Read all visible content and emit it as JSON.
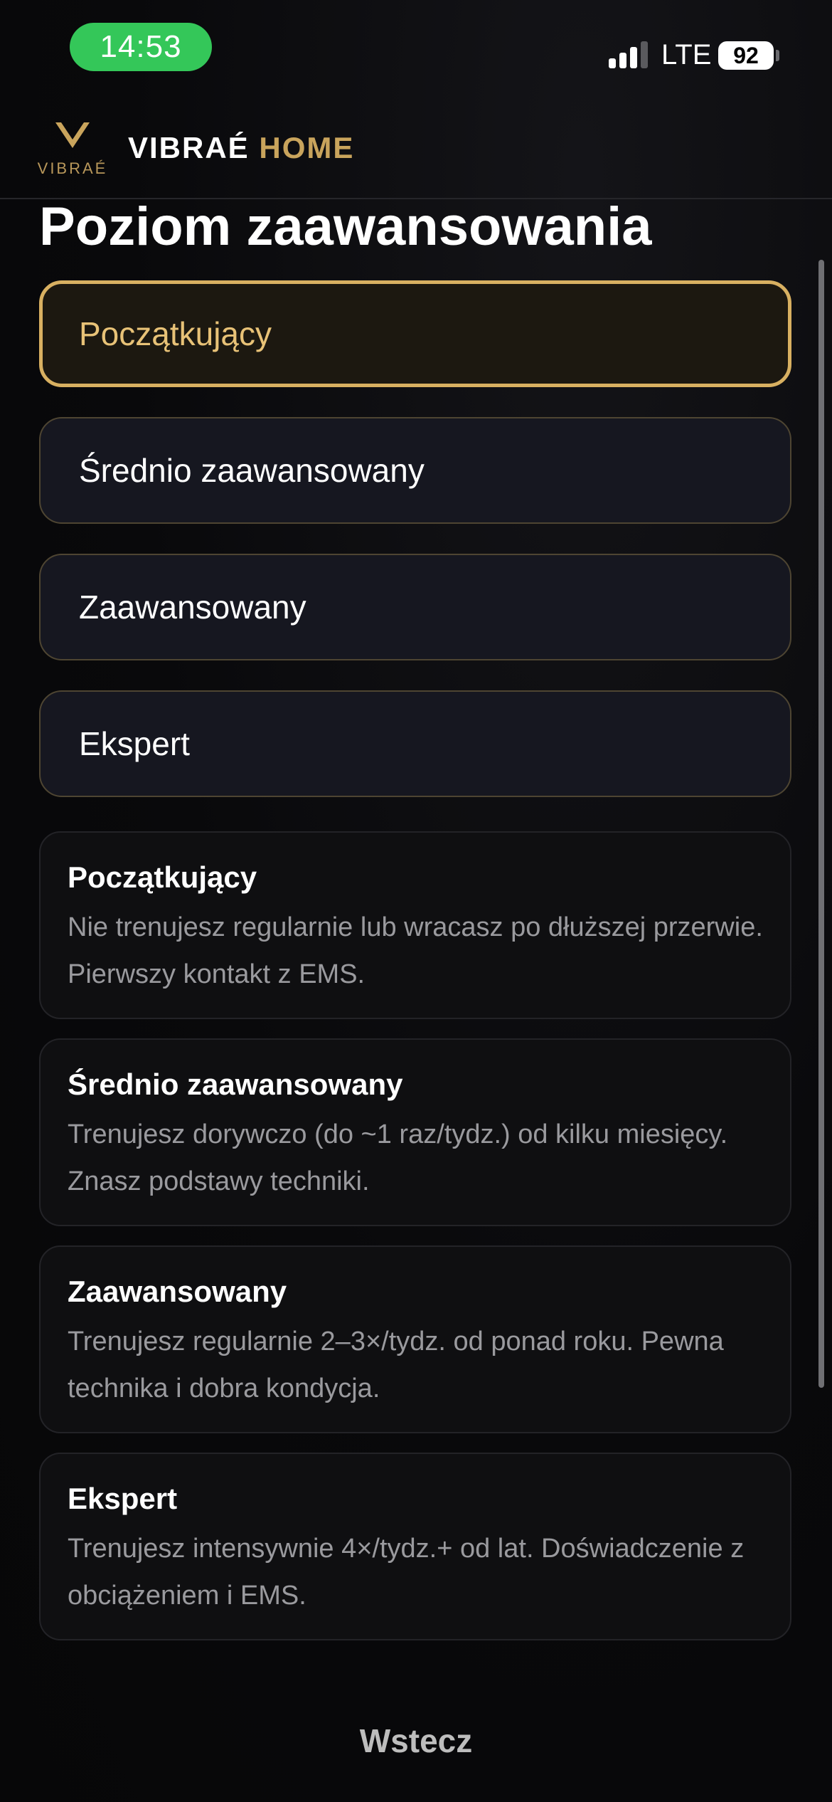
{
  "status_bar": {
    "time": "14:53",
    "network": "LTE",
    "battery": "92",
    "signal_bars_filled": 3,
    "signal_bars_total": 4
  },
  "header": {
    "logo_text": "VIBRAÉ",
    "brand_primary": "VIBRAÉ",
    "brand_secondary": "HOME",
    "brand_accent_color": "#c9a45c"
  },
  "page": {
    "title": "Poziom zaawansowania"
  },
  "options": [
    {
      "label": "Początkujący",
      "selected": true
    },
    {
      "label": "Średnio zaawansowany",
      "selected": false
    },
    {
      "label": "Zaawansowany",
      "selected": false
    },
    {
      "label": "Ekspert",
      "selected": false
    }
  ],
  "descriptions": [
    {
      "title": "Początkujący",
      "text": "Nie trenujesz regularnie lub wracasz po dłuższej przerwie. Pierwszy kontakt z EMS."
    },
    {
      "title": "Średnio zaawansowany",
      "text": "Trenujesz dorywczo (do ~1 raz/tydz.) od kilku miesięcy. Znasz podstawy techniki."
    },
    {
      "title": "Zaawansowany",
      "text": "Trenujesz regularnie 2–3×/tydz. od ponad roku. Pewna technika i dobra kondycja."
    },
    {
      "title": "Ekspert",
      "text": "Trenujesz intensywnie 4×/tydz.+ od lat. Doświadczenie z obciążeniem i EMS."
    }
  ],
  "footer": {
    "back_label": "Wstecz"
  },
  "colors": {
    "background": "#09090b",
    "selected_border": "#d8b061",
    "status_time_pill": "#34c759"
  }
}
